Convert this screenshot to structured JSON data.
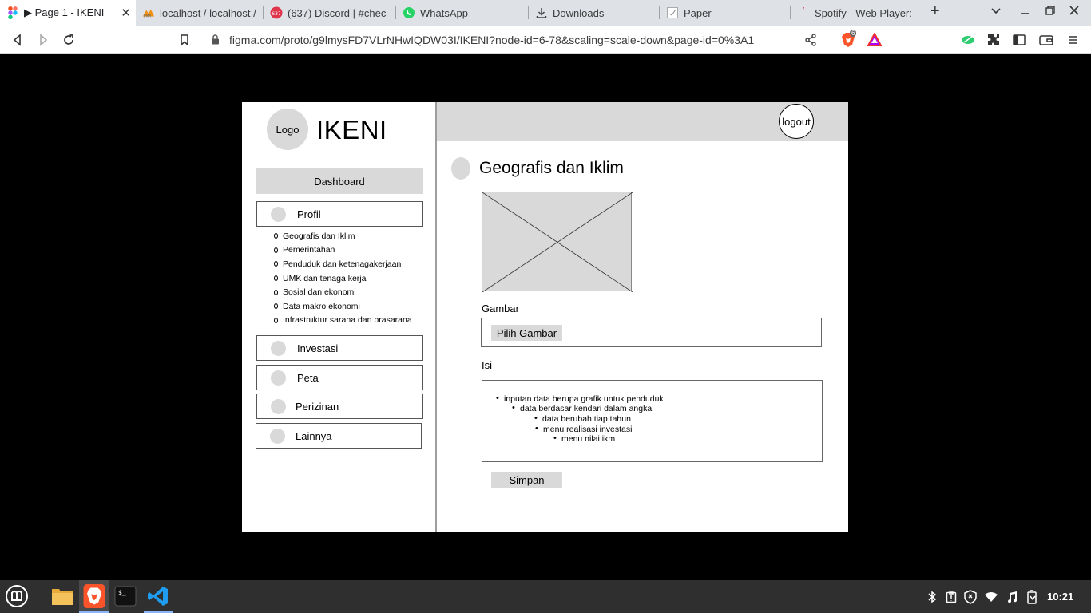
{
  "browser": {
    "tabs": [
      {
        "label": "▶ Page 1 - IKENI",
        "icon": "figma-icon",
        "active": true
      },
      {
        "label": "localhost / localhost /",
        "icon": "phpmyadmin-icon"
      },
      {
        "label": "(637) Discord | #chec",
        "icon": "discord-icon",
        "badge": "637"
      },
      {
        "label": "WhatsApp",
        "icon": "whatsapp-icon"
      },
      {
        "label": "Downloads",
        "icon": "download-icon"
      },
      {
        "label": "Paper",
        "icon": "paper-icon"
      },
      {
        "label": "Spotify - Web Player:",
        "icon": "spotify-icon"
      }
    ],
    "close_tab": "✕",
    "new_tab": "+",
    "url": "figma.com/proto/g9lmysFD7VLrNHwIQDW03I/IKENI?node-id=6-78&scaling=scale-down&page-id=0%3A1",
    "brave_badge": "6"
  },
  "app": {
    "logo_label": "Logo",
    "brand": "IKENI",
    "logout": "logout",
    "dashboard": "Dashboard",
    "menu": {
      "profil": "Profil",
      "investasi": "Investasi",
      "peta": "Peta",
      "perizinan": "Perizinan",
      "lainnya": "Lainnya"
    },
    "submenu": [
      "Geografis dan Iklim",
      "Pemerintahan",
      "Penduduk dan ketenagakerjaan",
      "UMK dan tenaga kerja",
      "Sosial dan ekonomi",
      "Data makro ekonomi",
      "Infrastruktur sarana dan prasarana"
    ],
    "page_title": "Geografis dan Iklim",
    "image_label": "Gambar",
    "pick_image": "Pilih Gambar",
    "content_label": "Isi",
    "content_items": [
      "inputan data berupa grafik untuk penduduk",
      "data berdasar kendari dalam angka",
      "data berubah tiap tahun",
      "menu realisasi investasi",
      "menu nilai ikm"
    ],
    "save": "Simpan"
  },
  "taskbar": {
    "clock": "10:21"
  },
  "colors": {
    "placeholder_gray": "#d9d9d9",
    "taskbar": "#2f2f2f",
    "tabbar": "#dee1e6"
  }
}
